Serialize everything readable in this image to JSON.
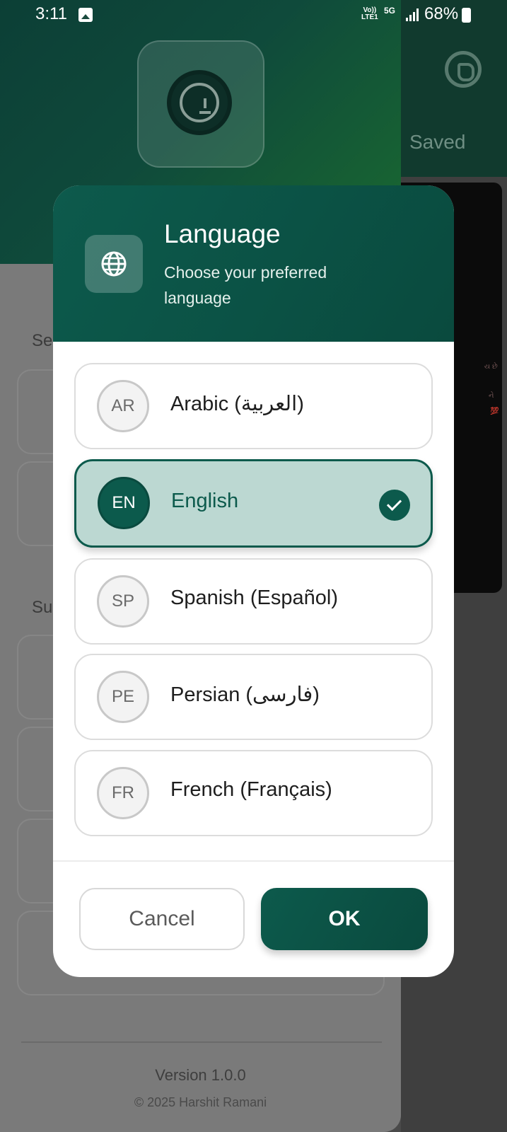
{
  "status_bar": {
    "time": "3:11",
    "network_volte": "Vo)) LTE1",
    "network_5g": "5G",
    "battery": "68%"
  },
  "background": {
    "saved_tab": "Saved",
    "sections": [
      "Se",
      "Su"
    ],
    "version": "Version 1.0.0",
    "copyright": "© 2025 Harshit Ramani"
  },
  "dialog": {
    "title": "Language",
    "subtitle": "Choose your preferred language",
    "languages": [
      {
        "code": "AR",
        "name": "Arabic (العربية)",
        "selected": false
      },
      {
        "code": "EN",
        "name": "English",
        "selected": true
      },
      {
        "code": "SP",
        "name": "Spanish (Español)",
        "selected": false
      },
      {
        "code": "PE",
        "name": "Persian (فارسی)",
        "selected": false
      },
      {
        "code": "FR",
        "name": "French (Français)",
        "selected": false
      }
    ],
    "cancel_label": "Cancel",
    "ok_label": "OK"
  },
  "colors": {
    "accent": "#0c5a4c",
    "selected_bg": "#bcd8d2"
  },
  "icons": {
    "header": "globe-icon",
    "selected": "check-icon",
    "app": "download-icon"
  }
}
